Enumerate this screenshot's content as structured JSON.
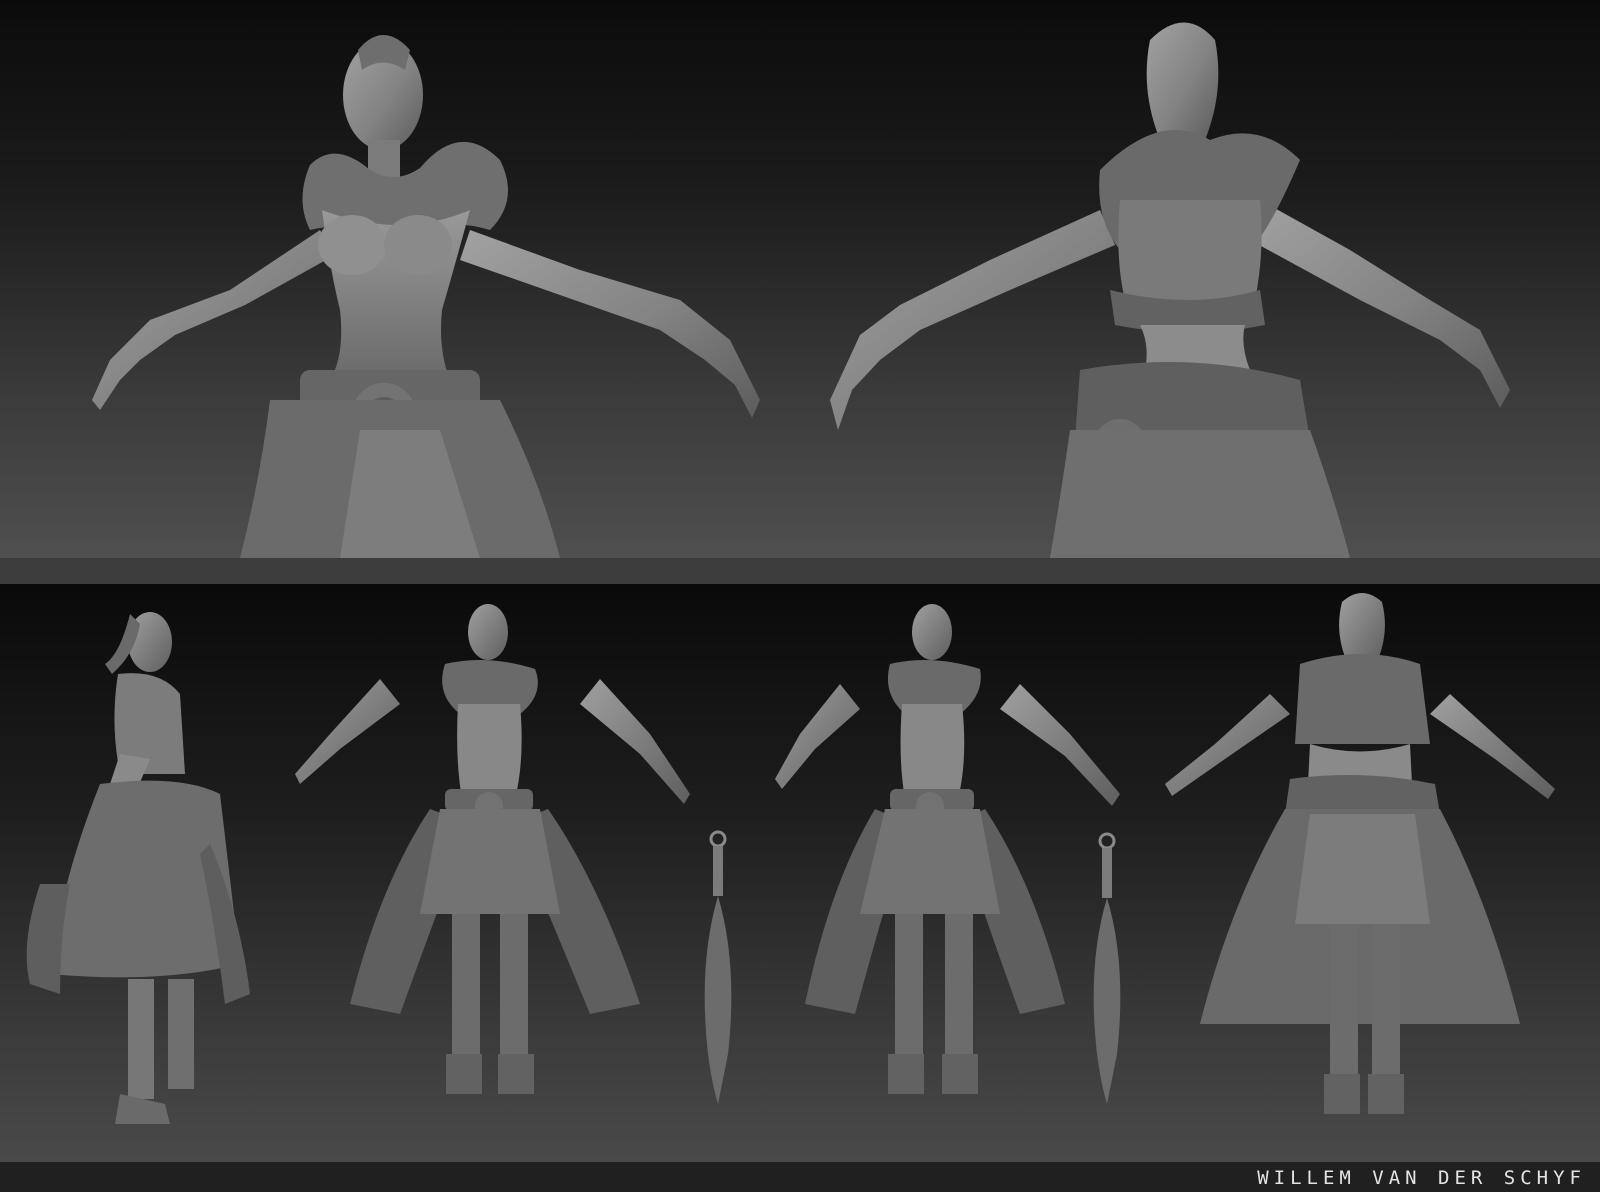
{
  "signature": "WILLEM VAN DER SCHYF",
  "colors": {
    "background_top": "#0b0b0b",
    "background_bottom": "#4f4f4f",
    "divider": "#3c3c3c",
    "footer": "#202020",
    "sculpt_clay": "#8a8a8a",
    "sculpt_shadow": "#555555",
    "signature_text": "#e4e4e4"
  },
  "panels": {
    "top": {
      "views": [
        "front-closeup",
        "back-closeup"
      ]
    },
    "bottom": {
      "views": [
        "side-full",
        "front-full",
        "three-quarter-full",
        "back-full"
      ],
      "props": [
        "fur-flail-prop",
        "fur-flail-prop"
      ]
    }
  }
}
